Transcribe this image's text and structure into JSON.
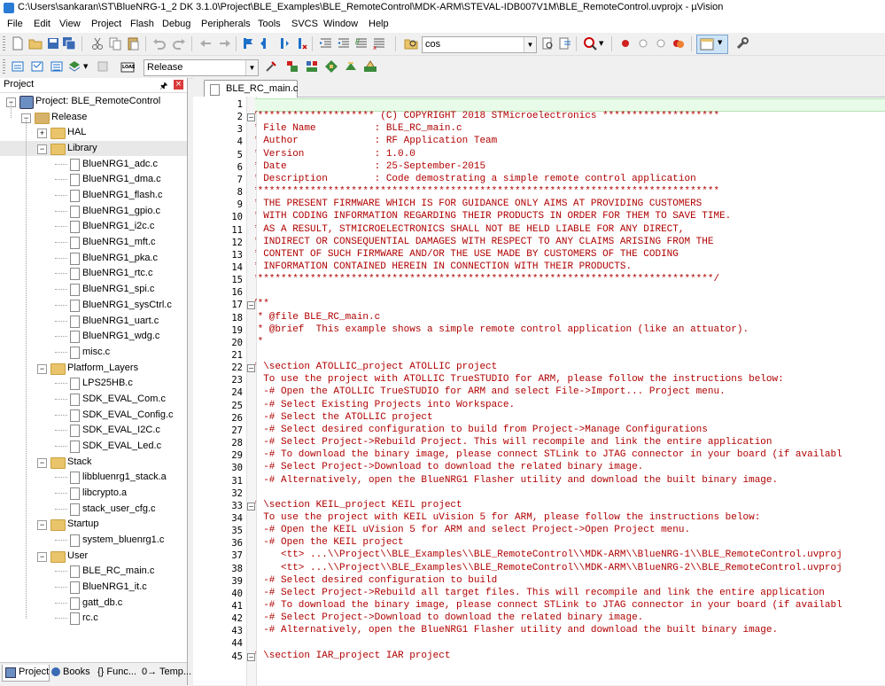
{
  "window": {
    "title": "C:\\Users\\sankaran\\ST\\BlueNRG-1_2 DK 3.1.0\\Project\\BLE_Examples\\BLE_RemoteControl\\MDK-ARM\\STEVAL-IDB007V1M\\BLE_RemoteControl.uvprojx - µVision"
  },
  "menu": [
    "File",
    "Edit",
    "View",
    "Project",
    "Flash",
    "Debug",
    "Peripherals",
    "Tools",
    "SVCS",
    "Window",
    "Help"
  ],
  "toolbar": {
    "find_value": "cos",
    "target_value": "Release",
    "icons": [
      "new-file-icon",
      "open-icon",
      "save-icon",
      "save-all-icon",
      "cut-icon",
      "copy-icon",
      "paste-icon",
      "undo-icon",
      "redo-icon",
      "back-icon",
      "forward-icon",
      "bookmark-icon",
      "prev-bookmark-icon",
      "next-bookmark-icon",
      "clear-bookmarks-icon",
      "indent-icon",
      "unindent-icon",
      "comment-icon",
      "uncomment-icon",
      "find-in-files-icon",
      "find-icon",
      "incremental-find-icon",
      "debug-icon",
      "breakpoint-icon",
      "disable-breakpoint-icon",
      "kill-breakpoints-icon",
      "window-layout-icon",
      "configure-icon"
    ]
  },
  "project_panel": {
    "title": "Project",
    "root": "Project: BLE_RemoteControl",
    "target": "Release",
    "groups": [
      {
        "name": "HAL",
        "files": []
      },
      {
        "name": "Library",
        "files": [
          "BlueNRG1_adc.c",
          "BlueNRG1_dma.c",
          "BlueNRG1_flash.c",
          "BlueNRG1_gpio.c",
          "BlueNRG1_i2c.c",
          "BlueNRG1_mft.c",
          "BlueNRG1_pka.c",
          "BlueNRG1_rtc.c",
          "BlueNRG1_spi.c",
          "BlueNRG1_sysCtrl.c",
          "BlueNRG1_uart.c",
          "BlueNRG1_wdg.c",
          "misc.c"
        ]
      },
      {
        "name": "Platform_Layers",
        "files": [
          "LPS25HB.c",
          "SDK_EVAL_Com.c",
          "SDK_EVAL_Config.c",
          "SDK_EVAL_I2C.c",
          "SDK_EVAL_Led.c"
        ]
      },
      {
        "name": "Stack",
        "files": [
          "libbluenrg1_stack.a",
          "libcrypto.a",
          "stack_user_cfg.c"
        ]
      },
      {
        "name": "Startup",
        "files": [
          "system_bluenrg1.c"
        ]
      },
      {
        "name": "User",
        "files": [
          "BLE_RC_main.c",
          "BlueNRG1_it.c",
          "gatt_db.c",
          "rc.c"
        ]
      }
    ]
  },
  "bottom_tabs": [
    "Project",
    "Books",
    "{} Func...",
    "0→ Temp..."
  ],
  "editor": {
    "tab": "BLE_RC_main.c",
    "lines": [
      "",
      "/******************** (C) COPYRIGHT 2018 STMicroelectronics ********************",
      "* File Name          : BLE_RC_main.c",
      "* Author             : RF Application Team",
      "* Version            : 1.0.0",
      "* Date               : 25-September-2015",
      "* Description        : Code demostrating a simple remote control application",
      "********************************************************************************",
      "* THE PRESENT FIRMWARE WHICH IS FOR GUIDANCE ONLY AIMS AT PROVIDING CUSTOMERS",
      "* WITH CODING INFORMATION REGARDING THEIR PRODUCTS IN ORDER FOR THEM TO SAVE TIME.",
      "* AS A RESULT, STMICROELECTRONICS SHALL NOT BE HELD LIABLE FOR ANY DIRECT,",
      "* INDIRECT OR CONSEQUENTIAL DAMAGES WITH RESPECT TO ANY CLAIMS ARISING FROM THE",
      "* CONTENT OF SUCH FIRMWARE AND/OR THE USE MADE BY CUSTOMERS OF THE CODING",
      "* INFORMATION CONTAINED HEREIN IN CONNECTION WITH THEIR PRODUCTS.",
      "*******************************************************************************/",
      "",
      "/**",
      " * @file BLE_RC_main.c",
      " * @brief  This example shows a simple remote control application (like an attuator).",
      " *",
      "",
      "* \\section ATOLLIC_project ATOLLIC project",
      "  To use the project with ATOLLIC TrueSTUDIO for ARM, please follow the instructions below:",
      "  -# Open the ATOLLIC TrueSTUDIO for ARM and select File->Import... Project menu.",
      "  -# Select Existing Projects into Workspace.",
      "  -# Select the ATOLLIC project",
      "  -# Select desired configuration to build from Project->Manage Configurations",
      "  -# Select Project->Rebuild Project. This will recompile and link the entire application",
      "  -# To download the binary image, please connect STLink to JTAG connector in your board (if availabl",
      "  -# Select Project->Download to download the related binary image.",
      "  -# Alternatively, open the BlueNRG1 Flasher utility and download the built binary image.",
      "",
      "* \\section KEIL_project KEIL project",
      "  To use the project with KEIL uVision 5 for ARM, please follow the instructions below:",
      "  -# Open the KEIL uVision 5 for ARM and select Project->Open Project menu.",
      "  -# Open the KEIL project",
      "     <tt> ...\\\\Project\\\\BLE_Examples\\\\BLE_RemoteControl\\\\MDK-ARM\\\\BlueNRG-1\\\\BLE_RemoteControl.uvproj",
      "     <tt> ...\\\\Project\\\\BLE_Examples\\\\BLE_RemoteControl\\\\MDK-ARM\\\\BlueNRG-2\\\\BLE_RemoteControl.uvproj",
      "  -# Select desired configuration to build",
      "  -# Select Project->Rebuild all target files. This will recompile and link the entire application",
      "  -# To download the binary image, please connect STLink to JTAG connector in your board (if availabl",
      "  -# Select Project->Download to download the related binary image.",
      "  -# Alternatively, open the BlueNRG1 Flasher utility and download the built binary image.",
      "",
      "* \\section IAR_project IAR project"
    ],
    "fold_lines": [
      2,
      17,
      22,
      33,
      45
    ],
    "colors": {
      "comment": "#b00000",
      "current_line": "#e8fbe8"
    }
  }
}
